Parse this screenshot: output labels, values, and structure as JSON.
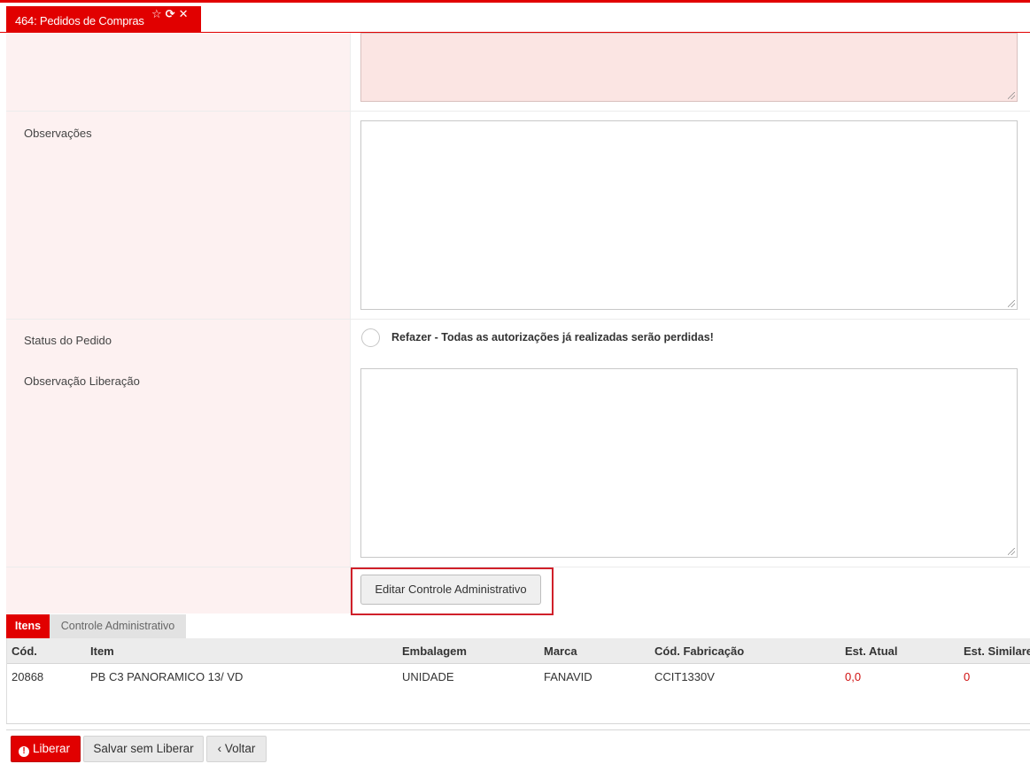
{
  "tab": {
    "title": "464: Pedidos de Compras",
    "icons": [
      "star-icon",
      "refresh-icon",
      "close-icon"
    ]
  },
  "form": {
    "observacoes_label": "Observações",
    "status_label": "Status do Pedido",
    "status_option": "Refazer - Todas as autorizações já realizadas serão perdidas!",
    "obs_liberacao_label": "Observação Liberação",
    "edit_button": "Editar Controle Administrativo"
  },
  "bottom_tabs": [
    {
      "label": "Itens",
      "active": true
    },
    {
      "label": "Controle Administrativo",
      "active": false
    }
  ],
  "grid": {
    "columns": [
      "Cód.",
      "Item",
      "Embalagem",
      "Marca",
      "Cód. Fabricação",
      "Est. Atual",
      "Est. Similare"
    ],
    "rows": [
      [
        "20868",
        "PB C3 PANORAMICO 13/ VD",
        "UNIDADE",
        "FANAVID",
        "CCIT1330V",
        "0,0",
        "0"
      ]
    ]
  },
  "actions": {
    "liberar": "Liberar",
    "salvar": "Salvar sem Liberar",
    "voltar": "Voltar"
  },
  "colors": {
    "accent": "#e10000",
    "label_bg": "#fdf1f1",
    "readonly_bg": "#fbe5e3"
  }
}
